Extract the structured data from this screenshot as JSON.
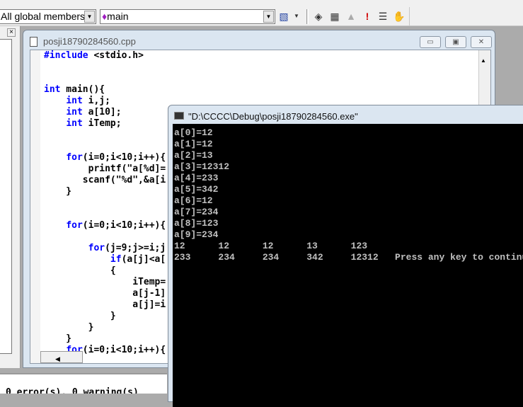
{
  "toolbar": {
    "scope_combo": "All global members",
    "function_combo": "main",
    "icons": [
      "wizard-icon",
      "compile-icon",
      "build-icon",
      "stop-build-icon",
      "execute-icon",
      "step-icon",
      "breakpoint-icon"
    ]
  },
  "editor": {
    "title": "posji18790284560.cpp",
    "lines": [
      "#include <stdio.h>",
      "",
      "",
      "int main(){",
      "    int i,j;",
      "    int a[10];",
      "    int iTemp;",
      "",
      "",
      "    for(i=0;i<10;i++){",
      "        printf(\"a[%d]=",
      "       scanf(\"%d\",&a[i",
      "    }",
      "",
      "",
      "    for(i=0;i<10;i++){",
      "",
      "        for(j=9;j>=i;j",
      "            if(a[j]<a[",
      "            {",
      "                iTemp=",
      "                a[j-1]",
      "                a[j]=i",
      "            }",
      "        }",
      "    }",
      "    for(i=0;i<10;i++){"
    ]
  },
  "console": {
    "title": "\"D:\\CCCC\\Debug\\posji18790284560.exe\"",
    "output": "a[0]=12\na[1]=12\na[2]=13\na[3]=12312\na[4]=233\na[5]=342\na[6]=12\na[7]=234\na[8]=123\na[9]=234\n12      12      12      13      123\n233     234     234     342     12312   Press any key to continue"
  },
  "output_panel": {
    "text": "0 error(s), 0 warning(s)"
  },
  "colors": {
    "keyword": "#0000ff",
    "console_bg": "#000000",
    "console_text": "#c0c0c0"
  }
}
